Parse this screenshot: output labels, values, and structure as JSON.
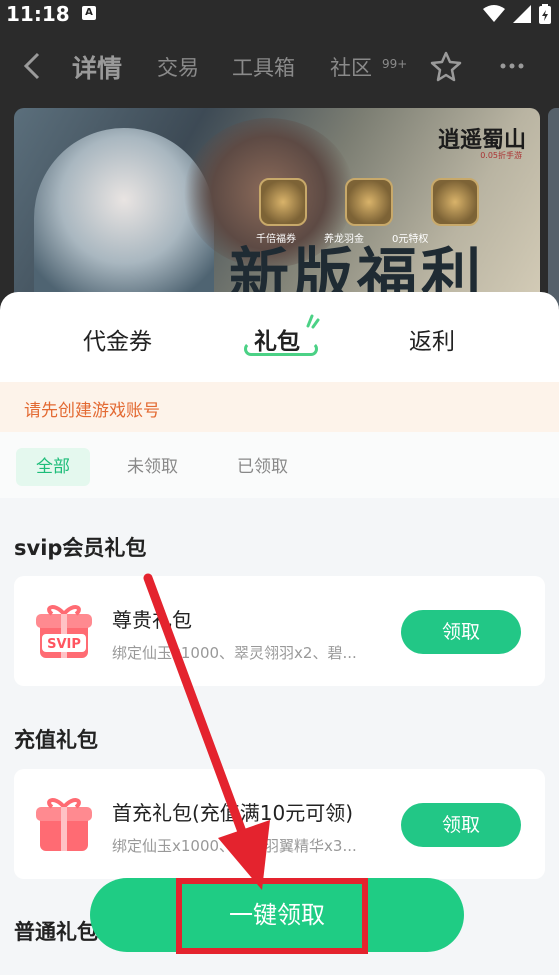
{
  "status_bar": {
    "time": "11:18",
    "indicator": "A"
  },
  "nav": {
    "tabs": [
      "详情",
      "交易",
      "工具箱",
      "社区"
    ],
    "community_badge": "99+"
  },
  "banner": {
    "logo": "逍遥蜀山",
    "logo_sub": "0.05折手游",
    "icon_labels": [
      "千倍福券",
      "养龙羽金",
      "0元特权"
    ],
    "title": "新版福利"
  },
  "sheet": {
    "tabs": [
      "代金券",
      "礼包",
      "返利"
    ],
    "active_tab": "礼包",
    "notice": "请先创建游戏账号",
    "filters": [
      "全部",
      "未领取",
      "已领取"
    ]
  },
  "sections": [
    {
      "title": "svip会员礼包",
      "items": [
        {
          "icon_label": "SVIP",
          "title": "尊贵礼包",
          "desc": "绑定仙玉x1000、翠灵翎羽x2、碧...",
          "button": "领取"
        }
      ]
    },
    {
      "title": "充值礼包",
      "items": [
        {
          "title": "首充礼包(充值满10元可领)",
          "desc": "绑定仙玉x1000、初级羽翼精华x3...",
          "button": "领取"
        }
      ]
    },
    {
      "title": "普通礼包"
    }
  ],
  "bottom_button": "一键领取",
  "colors": {
    "accent": "#22c786",
    "annotation": "#e4232e",
    "notice_text": "#e36a33"
  }
}
